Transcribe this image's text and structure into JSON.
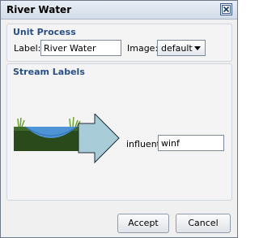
{
  "window": {
    "title": "River Water"
  },
  "unit_process": {
    "heading": "Unit Process",
    "label_caption": "Label:",
    "label_value": "River Water",
    "image_caption": "Image:",
    "image_value": "default"
  },
  "stream_labels": {
    "heading": "Stream Labels",
    "influent_caption": "influent",
    "influent_value": "winf"
  },
  "buttons": {
    "accept": "Accept",
    "cancel": "Cancel"
  },
  "colors": {
    "group_title": "#2a4f86",
    "arrow_fill": "#a9ccd9",
    "water": "#4d93d6",
    "soil": "#2b4a1c"
  }
}
